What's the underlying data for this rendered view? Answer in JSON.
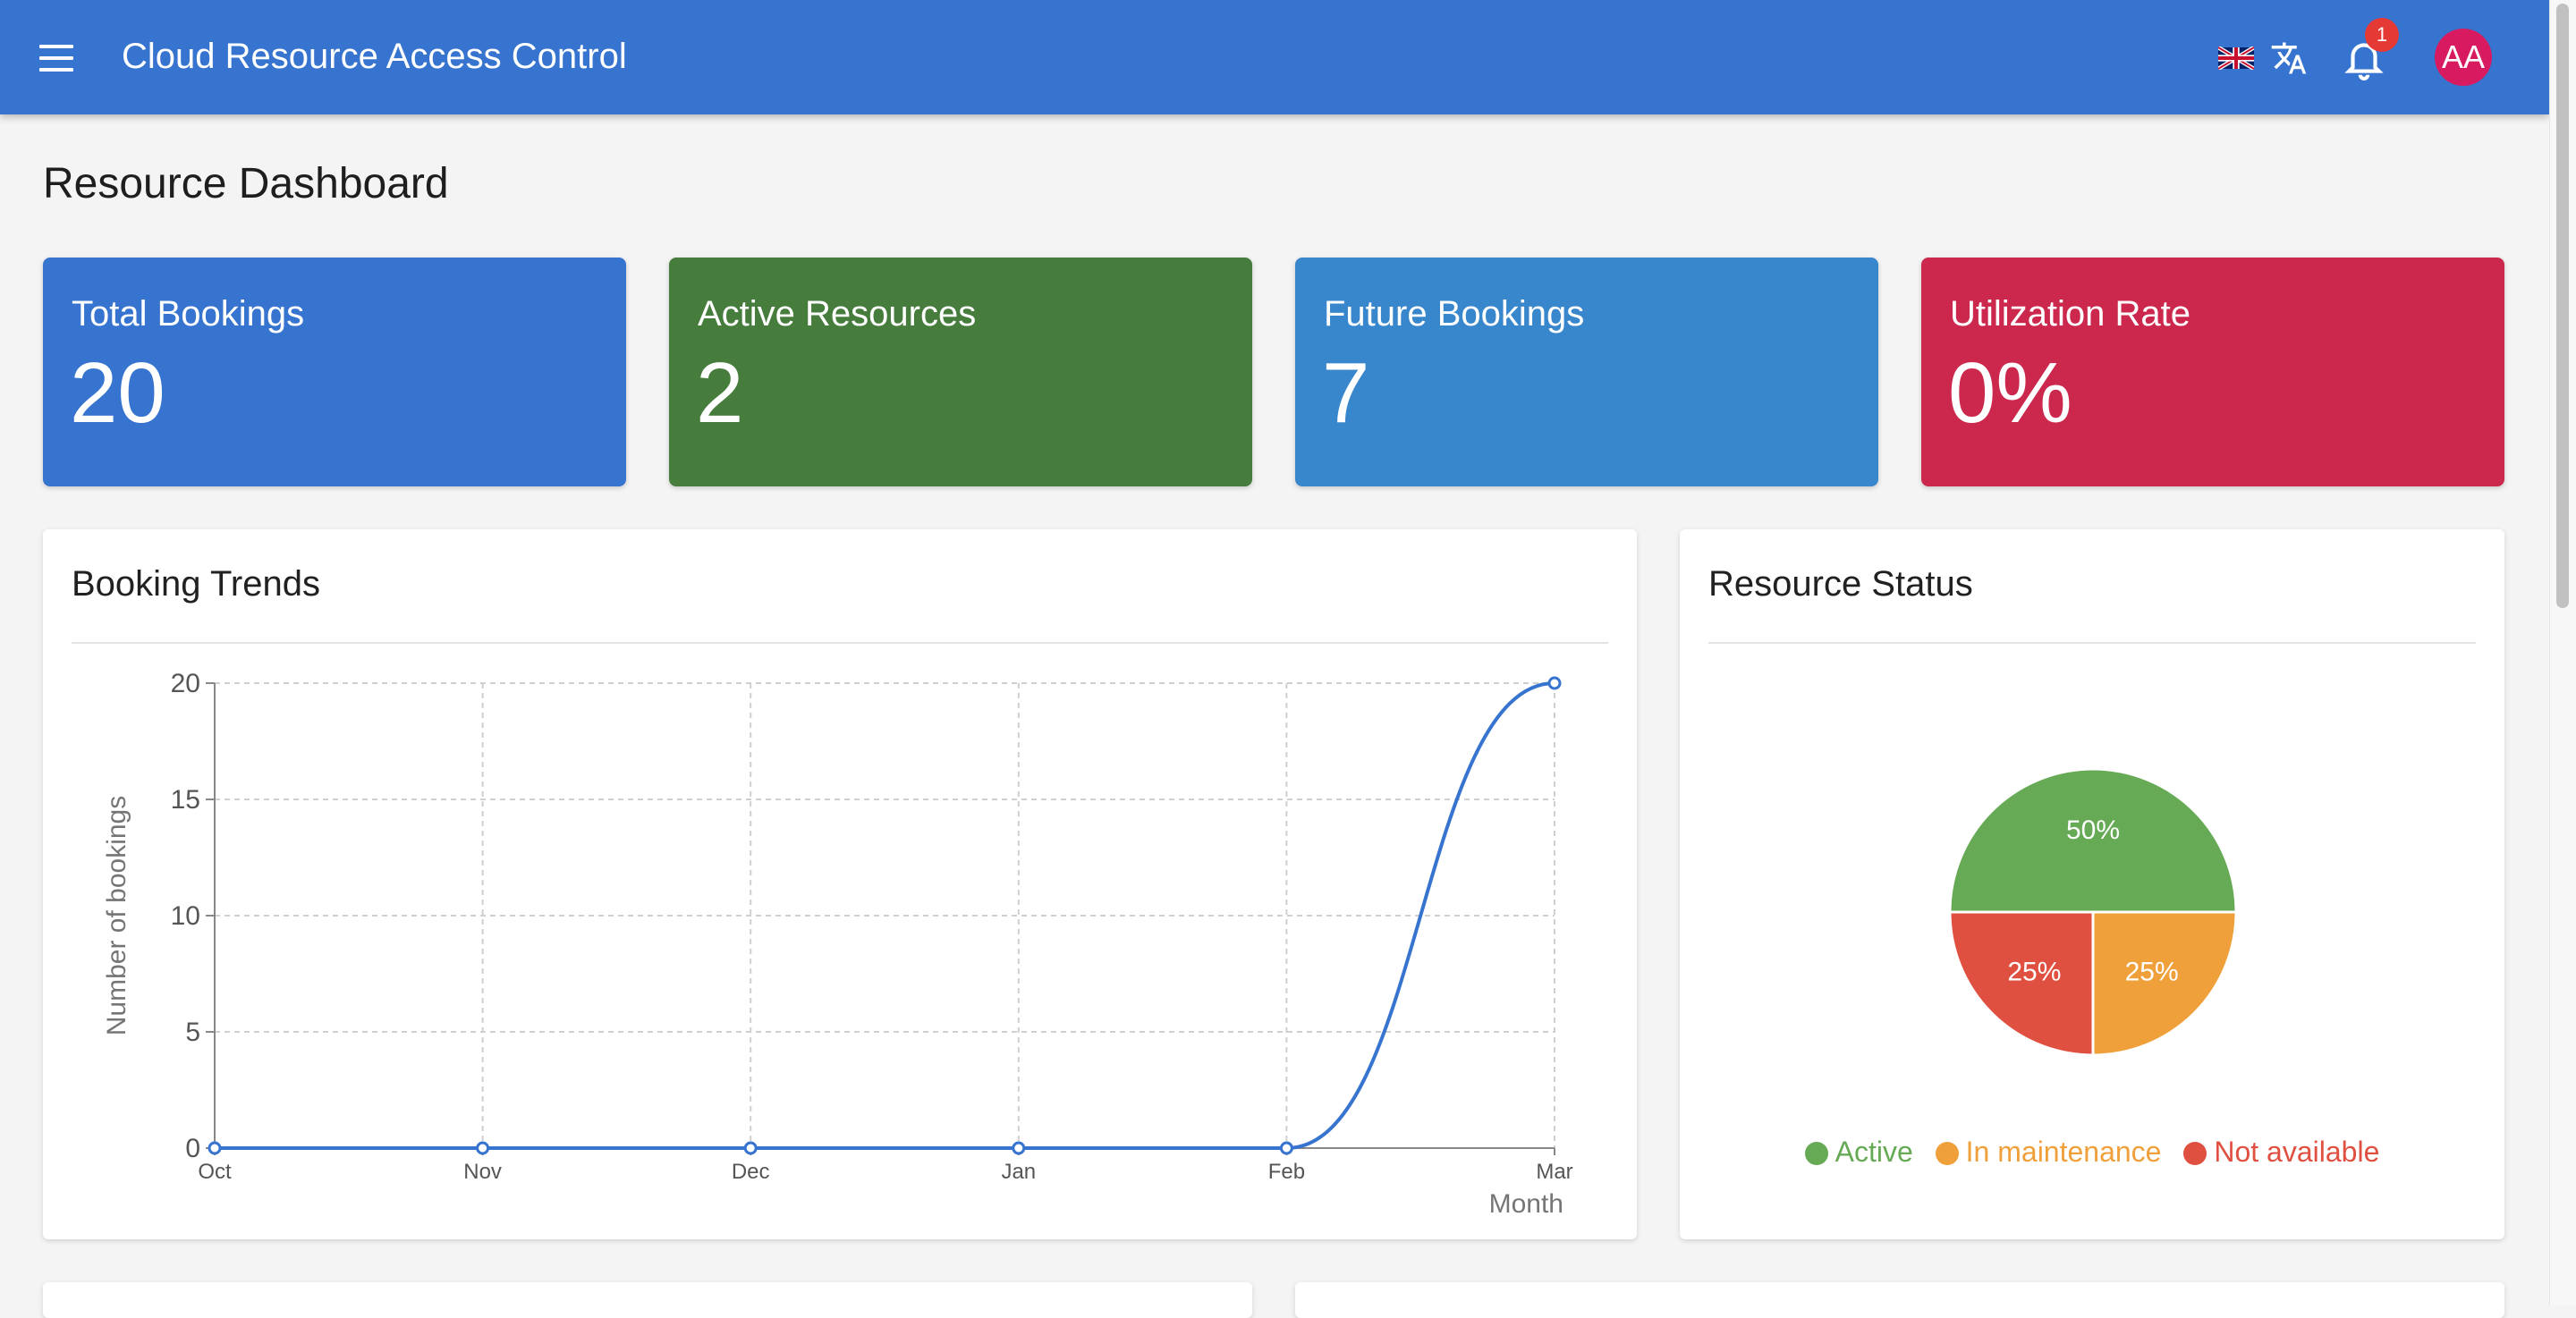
{
  "app": {
    "title": "Cloud Resource Access Control",
    "notifications_count": "1",
    "user_initials": "AA",
    "colors": {
      "appbar": "#3674cf",
      "avatar": "#d81b60",
      "badge": "#e53935"
    },
    "icons": [
      "menu-icon",
      "uk-flag-icon",
      "translate-icon",
      "bell-icon"
    ]
  },
  "page": {
    "title": "Resource Dashboard"
  },
  "stats": [
    {
      "label": "Total Bookings",
      "value": "20",
      "color": "#3674cf"
    },
    {
      "label": "Active Resources",
      "value": "2",
      "color": "#467c3c"
    },
    {
      "label": "Future Bookings",
      "value": "7",
      "color": "#3886cc"
    },
    {
      "label": "Utilization Rate",
      "value": "0%",
      "color": "#cc284e"
    }
  ],
  "trends": {
    "title": "Booking Trends"
  },
  "status": {
    "title": "Resource Status",
    "legend": [
      {
        "label": "Active",
        "color": "#66aa55"
      },
      {
        "label": "In maintenance",
        "color": "#f0a03a"
      },
      {
        "label": "Not available",
        "color": "#e05040"
      }
    ]
  },
  "chart_data": [
    {
      "type": "line",
      "x": [
        "Oct",
        "Nov",
        "Dec",
        "Jan",
        "Feb",
        "Mar"
      ],
      "series": [
        {
          "values": [
            0,
            0,
            0,
            0,
            0,
            20
          ],
          "color": "#3674cf"
        }
      ],
      "xlabel": "Month",
      "ylabel": "Number of bookings",
      "yticks": [
        0,
        5,
        10,
        15,
        20
      ],
      "ylim": [
        0,
        20
      ],
      "grid": true
    },
    {
      "type": "pie",
      "categories": [
        "Active",
        "In maintenance",
        "Not available"
      ],
      "values": [
        50,
        25,
        25
      ],
      "labels": [
        "50%",
        "25%",
        "25%"
      ],
      "colors": [
        "#66aa55",
        "#f0a03a",
        "#e05040"
      ],
      "legend": "bottom"
    }
  ]
}
